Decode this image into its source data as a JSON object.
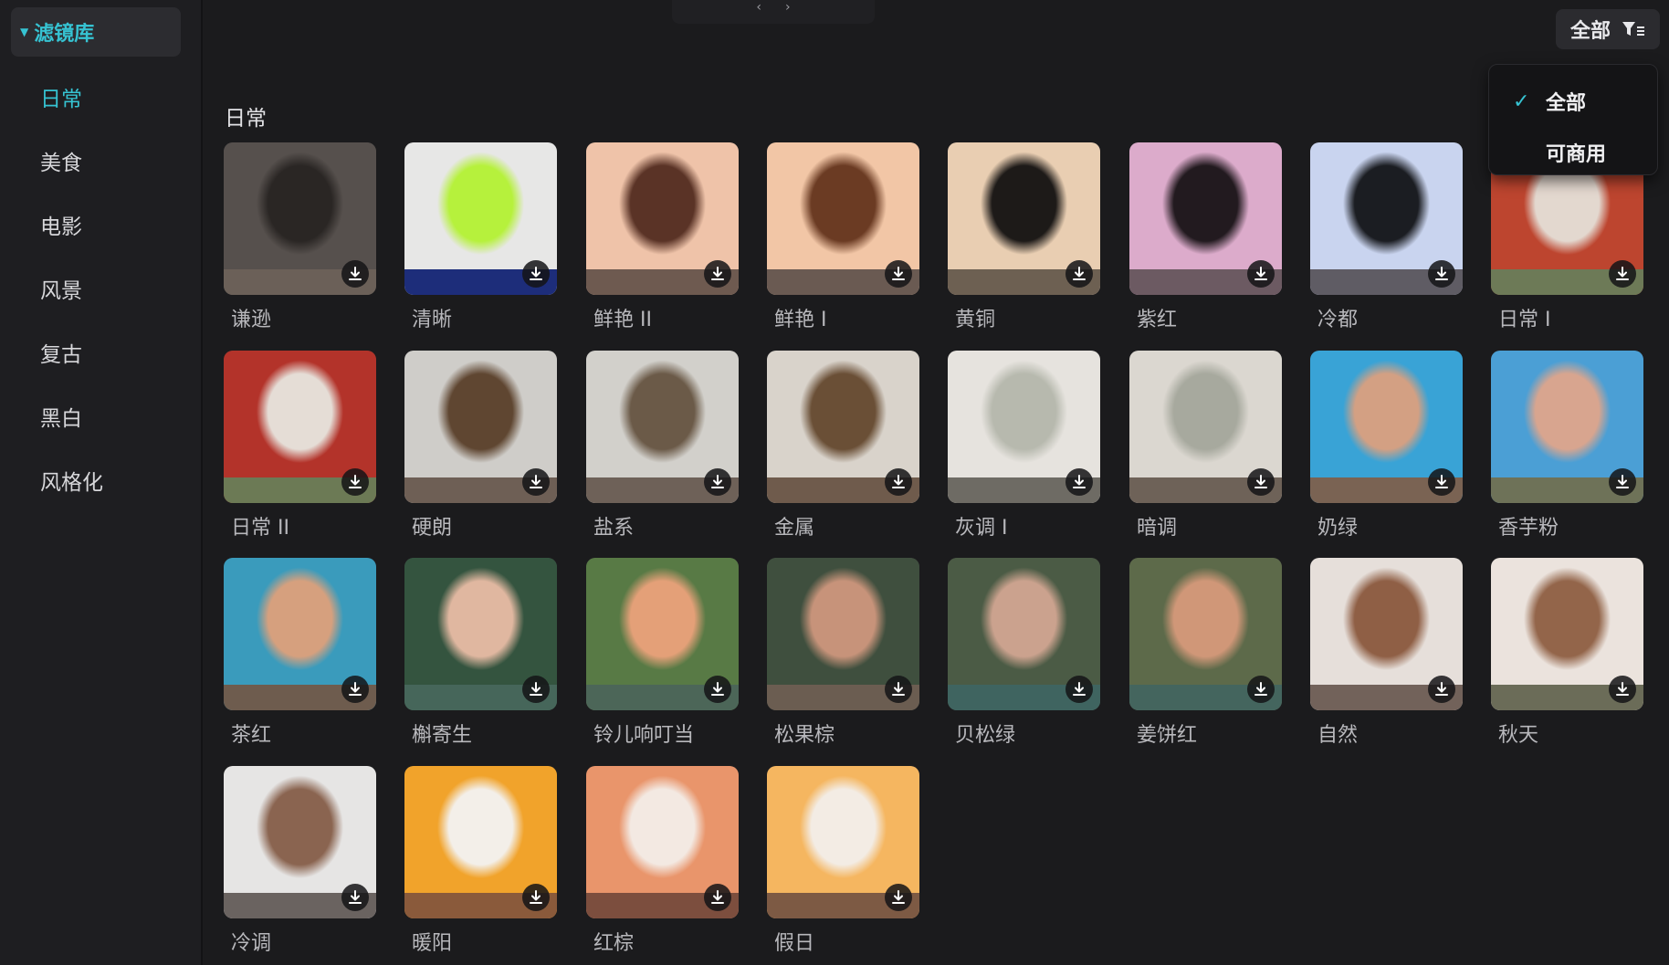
{
  "sidebar": {
    "library_title": "滤镜库",
    "categories": [
      {
        "label": "日常",
        "active": true
      },
      {
        "label": "美食",
        "active": false
      },
      {
        "label": "电影",
        "active": false
      },
      {
        "label": "风景",
        "active": false
      },
      {
        "label": "复古",
        "active": false
      },
      {
        "label": "黑白",
        "active": false
      },
      {
        "label": "风格化",
        "active": false
      }
    ]
  },
  "filter": {
    "button_label": "全部",
    "options": [
      {
        "label": "全部",
        "checked": true
      },
      {
        "label": "可商用",
        "checked": false
      }
    ]
  },
  "section_title": "日常",
  "filters": [
    {
      "label": "谦逊",
      "colors": [
        "#56504d",
        "#2a2624"
      ],
      "band": "#6b6058"
    },
    {
      "label": "清晰",
      "colors": [
        "#e7e7e6",
        "#b6f13c"
      ],
      "band": "#1d2d7a"
    },
    {
      "label": "鲜艳 II",
      "colors": [
        "#efc3a9",
        "#5a3326"
      ],
      "band": "#6e5a50"
    },
    {
      "label": "鲜艳 I",
      "colors": [
        "#f2c6a6",
        "#6b3b23"
      ],
      "band": "#6a5a52"
    },
    {
      "label": "黄铜",
      "colors": [
        "#e9ceb2",
        "#1d1a18"
      ],
      "band": "#6d6052"
    },
    {
      "label": "紫红",
      "colors": [
        "#dcabcb",
        "#221a1f"
      ],
      "band": "#6c5a62"
    },
    {
      "label": "冷都",
      "colors": [
        "#c9d4ef",
        "#1b1d22"
      ],
      "band": "#5f5c64"
    },
    {
      "label": "日常 I",
      "colors": [
        "#bd452f",
        "#e3d8cf"
      ],
      "band": "#6d7a57"
    },
    {
      "label": "日常 II",
      "colors": [
        "#b3332a",
        "#e5ddd6"
      ],
      "band": "#6c7a55"
    },
    {
      "label": "硬朗",
      "colors": [
        "#cfcdc9",
        "#5f4631"
      ],
      "band": "#6e5f55"
    },
    {
      "label": "盐系",
      "colors": [
        "#d2d0cb",
        "#6b5a48"
      ],
      "band": "#6e6158"
    },
    {
      "label": "金属",
      "colors": [
        "#d9d3cb",
        "#6a4f36"
      ],
      "band": "#6f5b4c"
    },
    {
      "label": "灰调 I",
      "colors": [
        "#e6e3de",
        "#b7b9ae"
      ],
      "band": "#6e6b64"
    },
    {
      "label": "暗调",
      "colors": [
        "#dbd7d0",
        "#a7a99e"
      ],
      "band": "#6e6258"
    },
    {
      "label": "奶绿",
      "colors": [
        "#39a3d6",
        "#d3a083"
      ],
      "band": "#7a6353"
    },
    {
      "label": "香芋粉",
      "colors": [
        "#4b9fd5",
        "#d8a58f"
      ],
      "band": "#6e7258"
    },
    {
      "label": "茶红",
      "colors": [
        "#3a9bbc",
        "#d6a07e"
      ],
      "band": "#6e5c4e"
    },
    {
      "label": "槲寄生",
      "colors": [
        "#34543f",
        "#e0b7a0"
      ],
      "band": "#46665a"
    },
    {
      "label": "铃儿响叮当",
      "colors": [
        "#587a45",
        "#e4a078"
      ],
      "band": "#4c6658"
    },
    {
      "label": "松果棕",
      "colors": [
        "#3f4f3e",
        "#c7937a"
      ],
      "band": "#6b5d51"
    },
    {
      "label": "贝松绿",
      "colors": [
        "#4b5b45",
        "#cba28e"
      ],
      "band": "#3f6460"
    },
    {
      "label": "姜饼红",
      "colors": [
        "#5d6a4a",
        "#d09778"
      ],
      "band": "#44655e"
    },
    {
      "label": "自然",
      "colors": [
        "#e6dfda",
        "#8f5f45"
      ],
      "band": "#72625a"
    },
    {
      "label": "秋天",
      "colors": [
        "#ebe3dd",
        "#93654a"
      ],
      "band": "#6b6c58"
    },
    {
      "label": "冷调",
      "colors": [
        "#e6e5e4",
        "#8a6450"
      ],
      "band": "#6a6360"
    },
    {
      "label": "暖阳",
      "colors": [
        "#f1a32b",
        "#f3efe9"
      ],
      "band": "#8a5a3b"
    },
    {
      "label": "红棕",
      "colors": [
        "#e9956b",
        "#f3e9e2"
      ],
      "band": "#7c4e3e"
    },
    {
      "label": "假日",
      "colors": [
        "#f5b660",
        "#f3ece4"
      ],
      "band": "#7d5a44"
    }
  ]
}
